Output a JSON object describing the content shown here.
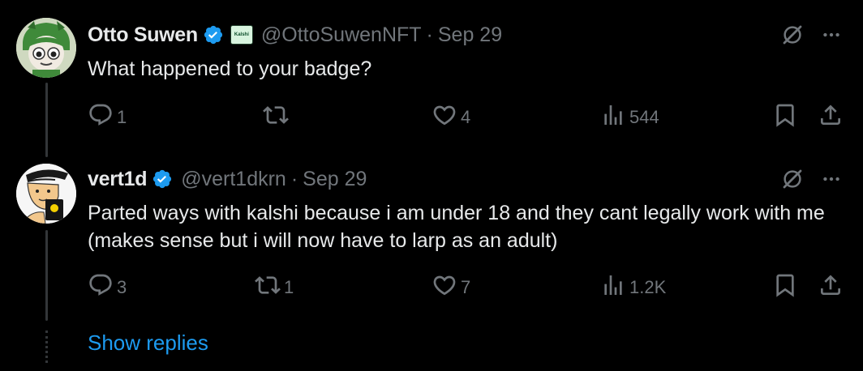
{
  "colors": {
    "background": "#000000",
    "text_primary": "#e7e9ea",
    "text_secondary": "#71767b",
    "accent": "#1d9bf0",
    "thread_line": "#333639"
  },
  "tweets": [
    {
      "name": "Otto Suwen",
      "verified": true,
      "affiliate_badge": "Kalshi",
      "handle": "@OttoSuwenNFT",
      "separator": "·",
      "date": "Sep 29",
      "text": "What happened to your badge?",
      "replies": "1",
      "reposts": "",
      "likes": "4",
      "views": "544",
      "avatar_icon": "green-hood-avatar"
    },
    {
      "name": "vert1d",
      "verified": true,
      "handle": "@vert1dkrn",
      "separator": "·",
      "date": "Sep 29",
      "text": "Parted ways with kalshi because i am under 18 and they cant legally work with me (makes sense but i will now have to larp as an adult)",
      "replies": "3",
      "reposts": "1",
      "likes": "7",
      "views": "1.2K",
      "avatar_icon": "sketch-avatar"
    }
  ],
  "show_replies_label": "Show replies",
  "icons": {
    "grok": "grok-icon",
    "more": "more-icon",
    "reply": "reply-icon",
    "repost": "repost-icon",
    "like": "heart-icon",
    "views": "views-icon",
    "bookmark": "bookmark-icon",
    "share": "share-icon"
  }
}
